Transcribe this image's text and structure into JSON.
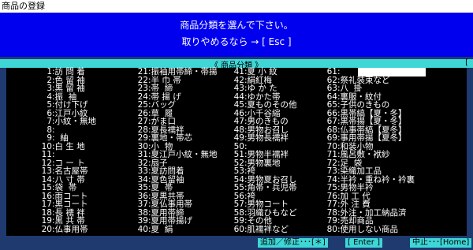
{
  "window": {
    "title": "商品の登録"
  },
  "prompt": {
    "line1": "商品分類を選んで下さい。",
    "line2": "取りやめるなら → [ Esc ]"
  },
  "panel": {
    "title": "《 商品分類 》",
    "right_bracket": "["
  },
  "columns": [
    [
      {
        "n": "1",
        "t": "訪 問 着"
      },
      {
        "n": "2",
        "t": "色 留 袖"
      },
      {
        "n": "3",
        "t": "黒 留 袖"
      },
      {
        "n": "4",
        "t": "振  袖"
      },
      {
        "n": "5",
        "t": "付け下げ"
      },
      {
        "n": "6",
        "t": "江戸小紋"
      },
      {
        "n": "7",
        "t": "小紋・無地"
      },
      {
        "n": "8",
        "t": ""
      },
      {
        "n": "9",
        "t": "  紬"
      },
      {
        "n": "10",
        "t": "白 生 地"
      },
      {
        "n": "11",
        "t": ""
      },
      {
        "n": "12",
        "t": "コ ー ト"
      },
      {
        "n": "13",
        "t": "名古屋帯"
      },
      {
        "n": "14",
        "t": "八 寸 帯"
      },
      {
        "n": "15",
        "t": "袋  帯"
      },
      {
        "n": "16",
        "t": "雨コート"
      },
      {
        "n": "17",
        "t": "黒コート"
      },
      {
        "n": "18",
        "t": "長 襦 袢"
      },
      {
        "n": "19",
        "t": "黒 共 帯"
      },
      {
        "n": "20",
        "t": "仏事用帯"
      }
    ],
    [
      {
        "n": "21",
        "t": "振袖用帯締・帯揚"
      },
      {
        "n": "22",
        "t": "半 巾 帯"
      },
      {
        "n": "23",
        "t": "帯  締"
      },
      {
        "n": "24",
        "t": "帯 揚 げ"
      },
      {
        "n": "25",
        "t": "バッグ"
      },
      {
        "n": "26",
        "t": "草  履"
      },
      {
        "n": "27",
        "t": "がま口"
      },
      {
        "n": "28",
        "t": "夏長襦袢"
      },
      {
        "n": "29",
        "t": "裏地・帯芯"
      },
      {
        "n": "30",
        "t": "小  物"
      },
      {
        "n": "31",
        "t": "夏江戸小紋・無地"
      },
      {
        "n": "32",
        "t": "扇子"
      },
      {
        "n": "33",
        "t": "夏訪問着"
      },
      {
        "n": "34",
        "t": "夏色留袖"
      },
      {
        "n": "35",
        "t": "夏  帯"
      },
      {
        "n": "36",
        "t": "夏黒共帯"
      },
      {
        "n": "37",
        "t": "夏仏事用帯"
      },
      {
        "n": "38",
        "t": "夏用帯締"
      },
      {
        "n": "39",
        "t": "夏用帯揚げ"
      },
      {
        "n": "40",
        "t": "夏  絹"
      }
    ],
    [
      {
        "n": "41",
        "t": "夏 小 紋"
      },
      {
        "n": "42",
        "t": "絹紅梅"
      },
      {
        "n": "43",
        "t": "ゆ か た"
      },
      {
        "n": "44",
        "t": "ゆかた帯"
      },
      {
        "n": "45",
        "t": "夏ものその他"
      },
      {
        "n": "46",
        "t": "小千谷縮"
      },
      {
        "n": "47",
        "t": "男のきもの"
      },
      {
        "n": "48",
        "t": "男物お召し"
      },
      {
        "n": "49",
        "t": "男物長襦袢"
      },
      {
        "n": "50",
        "t": ""
      },
      {
        "n": "51",
        "t": "男物半襦袢"
      },
      {
        "n": "52",
        "t": "男物裏地"
      },
      {
        "n": "53",
        "t": "袴"
      },
      {
        "n": "54",
        "t": "男物夏お召し"
      },
      {
        "n": "55",
        "t": "角帯・兵児帯"
      },
      {
        "n": "56",
        "t": "袴"
      },
      {
        "n": "57",
        "t": "男物コート"
      },
      {
        "n": "58",
        "t": "羽織ひもなど"
      },
      {
        "n": "59",
        "t": "その他"
      },
      {
        "n": "60",
        "t": "肌襦袢など"
      }
    ],
    [
      {
        "n": "61",
        "t": ""
      },
      {
        "n": "62",
        "t": "祭礼装束など"
      },
      {
        "n": "63",
        "t": "八  掛"
      },
      {
        "n": "64",
        "t": "裏服・紋付"
      },
      {
        "n": "65",
        "t": "子供のきもの"
      },
      {
        "n": "66",
        "t": "黒帯縞【夏・冬】"
      },
      {
        "n": "67",
        "t": "黒帯揚【夏・冬】"
      },
      {
        "n": "68",
        "t": "仏事帯縞【夏冬】"
      },
      {
        "n": "69",
        "t": "事用帯揚【夏冬】"
      },
      {
        "n": "70",
        "t": "和装小物"
      },
      {
        "n": "71",
        "t": "風呂敷・袱紗"
      },
      {
        "n": "72",
        "t": "足  袋"
      },
      {
        "n": "73",
        "t": "染織加工品"
      },
      {
        "n": "74",
        "t": "半衿・重ね衿・衿裏"
      },
      {
        "n": "75",
        "t": "男物半衿"
      },
      {
        "n": "76",
        "t": "加 工 代"
      },
      {
        "n": "77",
        "t": "外 注 費"
      },
      {
        "n": "78",
        "t": "外注・加工納品済"
      },
      {
        "n": "79",
        "t": "売却商品"
      },
      {
        "n": "80",
        "t": "使用しない商品"
      }
    ]
  ],
  "footer": {
    "add_edit": "追加／修正･･･[＊]",
    "enter": "[ Enter ]",
    "cancel": "中止･･･[Home]"
  },
  "colors": {
    "background": "#1e3a6e",
    "prompt": "#0000ee",
    "accent": "#3fd6d6",
    "list_bg": "#000000"
  }
}
